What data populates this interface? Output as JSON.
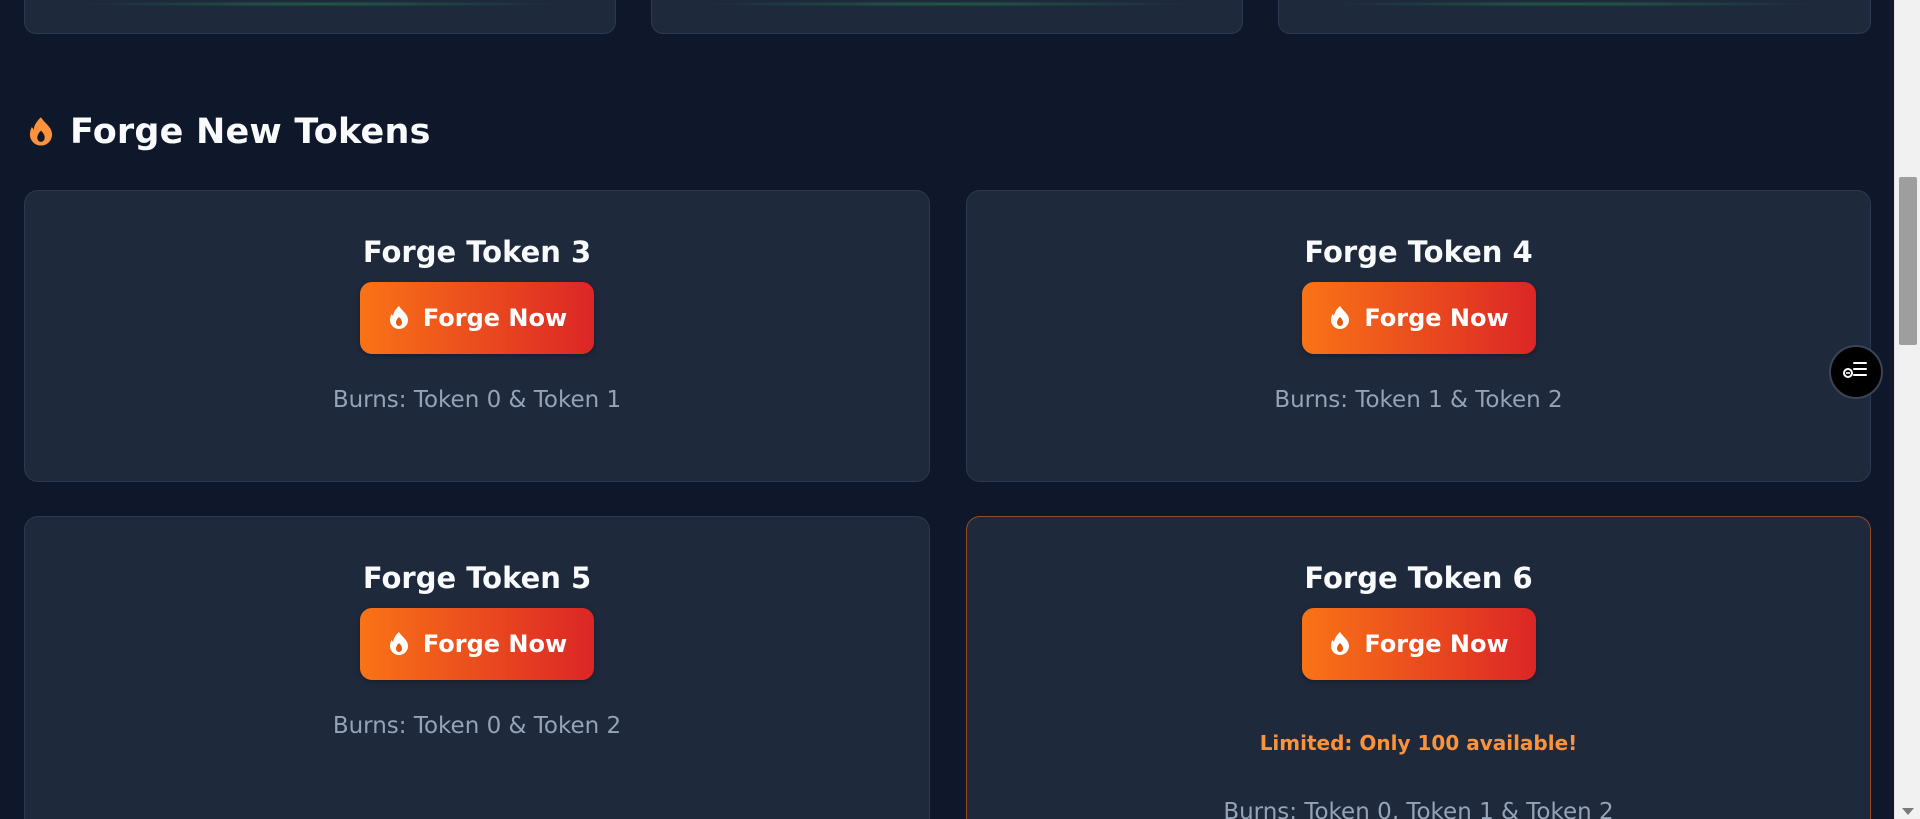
{
  "section": {
    "title": "Forge New Tokens",
    "icon": "flame-icon",
    "accent_color": "#fb923c"
  },
  "cards": [
    {
      "title": "Forge Token 3",
      "button_label": "Forge Now",
      "burns": "Burns: Token 0 & Token 1"
    },
    {
      "title": "Forge Token 4",
      "button_label": "Forge Now",
      "burns": "Burns: Token 1 & Token 2"
    },
    {
      "title": "Forge Token 5",
      "button_label": "Forge Now",
      "burns": "Burns: Token 0 & Token 2"
    },
    {
      "title": "Forge Token 6",
      "button_label": "Forge Now",
      "limited_note": "Limited: Only 100 available!",
      "burns": "Burns: Token 0, Token 1 & Token 2"
    }
  ],
  "colors": {
    "background": "#0f172a",
    "card": "#1e293b",
    "button_gradient_start": "#f97316",
    "button_gradient_end": "#dc2626",
    "limited_text": "#fb923c"
  },
  "fab": {
    "icon": "list-settings-icon"
  }
}
